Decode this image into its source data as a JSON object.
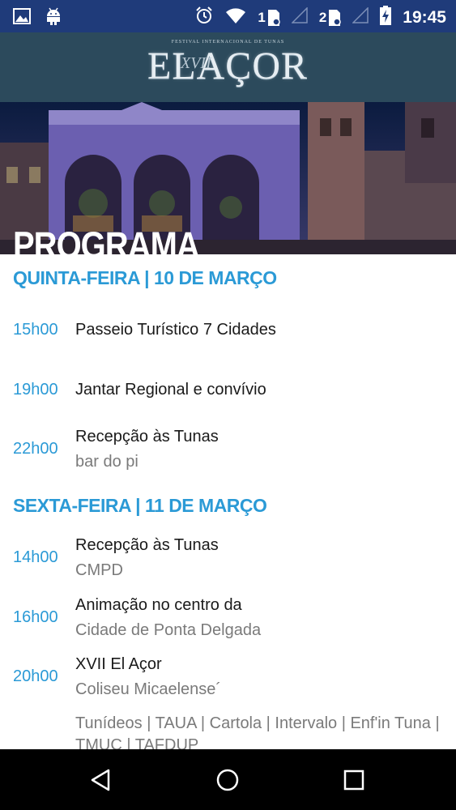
{
  "status_bar": {
    "time": "19:45",
    "sim1_label": "1",
    "sim2_label": "2",
    "icons": [
      "image-icon",
      "android-icon",
      "alarm-icon",
      "wifi-icon",
      "sim-card-icon",
      "signal-icon",
      "battery-charging-icon"
    ]
  },
  "app_bar": {
    "logo_text": "ELAÇOR",
    "logo_subtitle": "FESTIVAL INTERNACIONAL DE TUNAS",
    "logo_edition": "XVII"
  },
  "banner": {
    "title": "PROGRAMA"
  },
  "schedule": [
    {
      "day": "QUINTA-FEIRA  |  10 DE MARÇO",
      "events": [
        {
          "time": "15h00",
          "title": "Passeio Turístico 7 Cidades",
          "subtitle": ""
        },
        {
          "time": "19h00",
          "title": "Jantar Regional e convívio",
          "subtitle": ""
        },
        {
          "time": "22h00",
          "title": "Recepção às Tunas",
          "subtitle": "bar do pi"
        }
      ]
    },
    {
      "day": "SEXTA-FEIRA  |  11 DE MARÇO",
      "events": [
        {
          "time": "14h00",
          "title": "Recepção às Tunas",
          "subtitle": "CMPD"
        },
        {
          "time": "16h00",
          "title": "Animação no centro da",
          "subtitle": "Cidade de Ponta Delgada"
        },
        {
          "time": "20h00",
          "title": "XVII El Açor",
          "subtitle": "Coliseu Micaelense´",
          "extra": "Tunídeos | TAUA | Cartola | Intervalo | Enf'in Tuna | TMUC | TAFDUP"
        }
      ]
    }
  ],
  "nav_bar": {
    "icons": [
      "back-icon",
      "home-icon",
      "recents-icon"
    ]
  },
  "colors": {
    "status_bar": "#1f3b7a",
    "app_bar": "#2c4a5c",
    "accent": "#2b9ad6"
  }
}
